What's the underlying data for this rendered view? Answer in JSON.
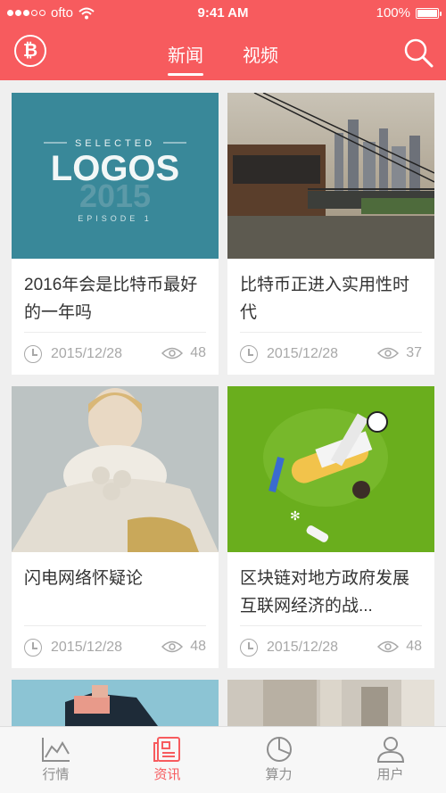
{
  "status_bar": {
    "carrier": "ofto",
    "time": "9:41 AM",
    "battery": "100%",
    "battery_level": 1.0
  },
  "nav": {
    "logo_symbol": "₿",
    "tabs": [
      {
        "label": "新闻",
        "active": true
      },
      {
        "label": "视频",
        "active": false
      }
    ]
  },
  "feed": {
    "cards": [
      {
        "title": "2016年会是比特币最好的一年吗",
        "date": "2015/12/28",
        "views": "48",
        "image": "selected-logos-2015"
      },
      {
        "title": "比特币正进入实用性时代",
        "date": "2015/12/28",
        "views": "37",
        "image": "cable-car-city"
      },
      {
        "title": "闪电网络怀疑论",
        "date": "2015/12/28",
        "views": "48",
        "image": "fashion-portrait"
      },
      {
        "title": "区块链对地方政府发展互联网经济的战...",
        "date": "2015/12/28",
        "views": "48",
        "image": "soccer-illustration"
      }
    ],
    "logo_image": {
      "small_top": "SELECTED",
      "big": "LOGOS",
      "year": "2015",
      "bottom": "EPISODE 1"
    }
  },
  "tabbar": {
    "items": [
      {
        "label": "行情",
        "icon": "chart-icon",
        "active": false
      },
      {
        "label": "资讯",
        "icon": "news-icon",
        "active": true
      },
      {
        "label": "算力",
        "icon": "pie-icon",
        "active": false
      },
      {
        "label": "用户",
        "icon": "user-icon",
        "active": false
      }
    ]
  },
  "colors": {
    "brand": "#f75b5e",
    "text": "#333333",
    "muted": "#a8a8a8"
  }
}
